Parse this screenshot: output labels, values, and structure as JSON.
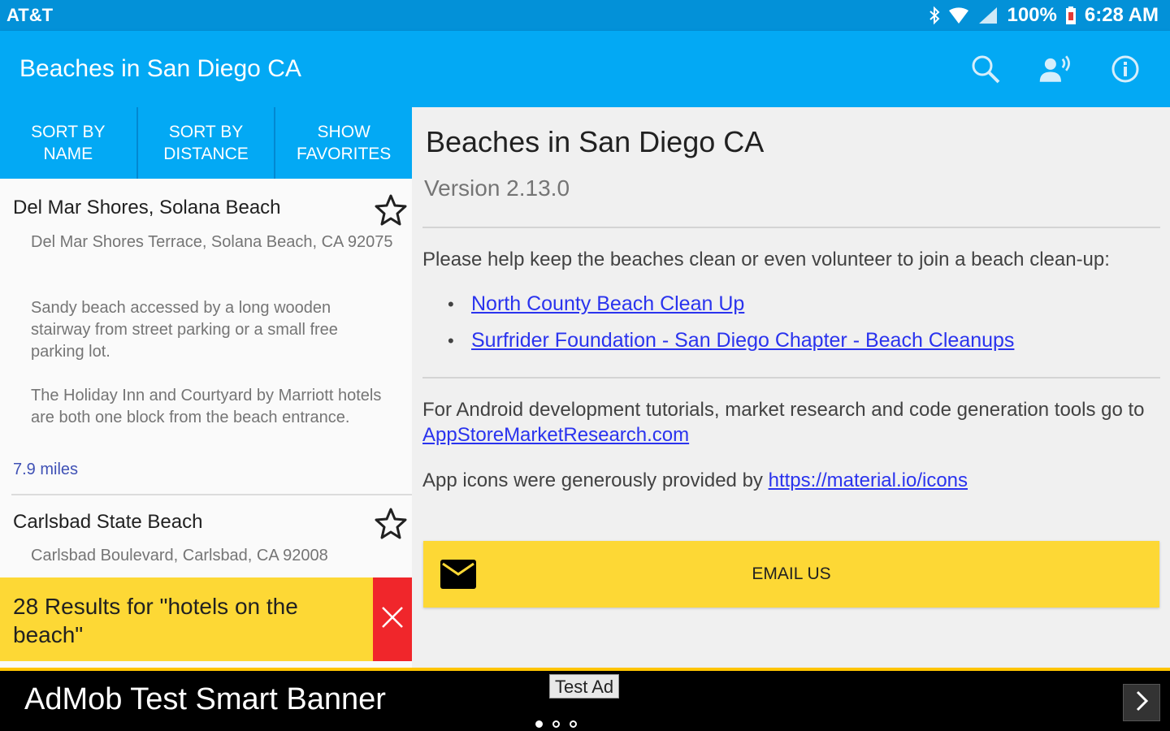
{
  "status_bar": {
    "carrier": "AT&T",
    "battery": "100%",
    "time": "6:28 AM"
  },
  "app_bar": {
    "title": "Beaches in San Diego CA",
    "icons": [
      "search-icon",
      "voice-search-icon",
      "info-icon"
    ]
  },
  "sort_tabs": [
    {
      "label": "SORT BY NAME"
    },
    {
      "label": "SORT BY DISTANCE"
    },
    {
      "label": "SHOW FAVORITES"
    }
  ],
  "beaches": [
    {
      "name": "Del Mar Shores, Solana Beach",
      "address": "Del Mar Shores Terrace, Solana Beach, CA 92075",
      "description": "Sandy beach accessed by a long wooden stairway from street parking or a small free parking lot.",
      "note": "The Holiday Inn and Courtyard by Marriott hotels are both one block from the beach entrance.",
      "distance": "7.9 miles"
    },
    {
      "name": "Carlsbad State Beach",
      "address": "Carlsbad Boulevard, Carlsbad, CA 92008"
    }
  ],
  "search_results": {
    "text": "28 Results for \"hotels on the beach\""
  },
  "about": {
    "title": "Beaches in San Diego CA",
    "version": "Version 2.13.0",
    "help_text": "Please help keep the beaches clean or even volunteer to join a beach clean-up:",
    "links": [
      {
        "label": "North County Beach Clean Up"
      },
      {
        "label": "Surfrider Foundation - San Diego Chapter - Beach Cleanups"
      }
    ],
    "dev_text": "For Android development tutorials, market research and code generation tools go to",
    "dev_link": "AppStoreMarketResearch.com",
    "icons_text": "App icons were generously provided by",
    "icons_link": "https://material.io/icons",
    "email_label": "EMAIL US"
  },
  "ad": {
    "title": "AdMob Test Smart Banner",
    "badge": "Test Ad"
  },
  "colors": {
    "primary": "#03a9f4",
    "status_bar": "#0391d8",
    "accent_yellow": "#fdd835",
    "close_red": "#f0262b",
    "link": "#2a33ee"
  }
}
